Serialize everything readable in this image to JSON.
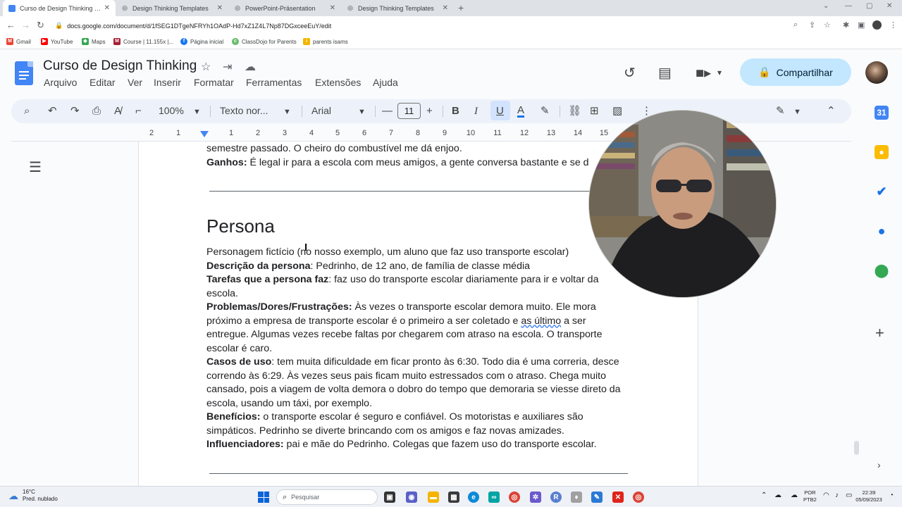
{
  "browser": {
    "tabs": [
      {
        "label": "Curso de Design Thinking - Docs",
        "favicon": "docs-icon",
        "active": true
      },
      {
        "label": "Design Thinking Templates",
        "favicon": "web-icon",
        "active": false
      },
      {
        "label": "PowerPoint-Präsentation",
        "favicon": "web-icon",
        "active": false
      },
      {
        "label": "Design Thinking Templates",
        "favicon": "web-icon",
        "active": false
      }
    ],
    "url": "docs.google.com/document/d/1fSEG1DTgeNFRYh1OAdP-Hd7xZ1Z4L7Np87DGxceeEuY/edit",
    "bookmarks": [
      {
        "label": "Gmail",
        "color": "#ea4335"
      },
      {
        "label": "YouTube",
        "color": "#ff0000"
      },
      {
        "label": "Maps",
        "color": "#34a853"
      },
      {
        "label": "Course | 11.155x |...",
        "color": "#a31f34"
      },
      {
        "label": "Página inicial",
        "color": "#1877f2"
      },
      {
        "label": "ClassDojo for Parents",
        "color": "#66bb6a"
      },
      {
        "label": "parents isams",
        "color": "#f4b400"
      }
    ]
  },
  "docs": {
    "title": "Curso de Design Thinking",
    "menu": [
      "Arquivo",
      "Editar",
      "Ver",
      "Inserir",
      "Formatar",
      "Ferramentas",
      "Extensões",
      "Ajuda"
    ],
    "share_label": "Compartilhar",
    "toolbar": {
      "zoom": "100%",
      "style": "Texto nor...",
      "font": "Arial",
      "font_size": "11"
    },
    "ruler_marks": [
      "2",
      "1",
      "1",
      "2",
      "3",
      "4",
      "5",
      "6",
      "7",
      "8",
      "9",
      "10",
      "11",
      "12",
      "13",
      "14",
      "15"
    ]
  },
  "document": {
    "top_line1": "semestre passado. O cheiro do combustível me dá enjoo.",
    "top_ganhos_label": "Ganhos:",
    "top_ganhos_text": " É legal ir para a escola com meus amigos, a gente conversa bastante e se d",
    "heading": "Persona",
    "intro": "Personagem fictício (no nosso exemplo, um aluno que faz uso transporte escolar)",
    "descricao_label": "Descrição da persona",
    "descricao_text": ": Pedrinho, de 12 ano, de família de classe média",
    "tarefas_label": "Tarefas que a persona faz",
    "tarefas_text": ": faz uso do transporte escolar diariamente para ir e voltar da escola.",
    "problemas_label": "Problemas/Dores/Frustrações:",
    "problemas_text_a": " Às vezes o transporte escolar demora muito. Ele mora próximo a empresa de transporte escolar é o primeiro a ser coletado e ",
    "problemas_misspelled": "as último",
    "problemas_text_b": " a ser entregue. Algumas vezes recebe faltas por chegarem com atraso na escola. O transporte escolar é caro.",
    "casos_label": "Casos de uso",
    "casos_text": ": tem muita dificuldade em ficar pronto às 6:30. Todo dia é uma correria, desce correndo às 6:29. Às vezes seus pais ficam muito estressados com o atraso. Chega muito cansado, pois a viagem de volta demora o dobro do tempo que demoraria se viesse direto da escola, usando um táxi, por exemplo.",
    "beneficios_label": "Benefícios:",
    "beneficios_text": " o transporte escolar é seguro e confiável. Os motoristas e auxiliares são simpáticos. Pedrinho se diverte brincando com os amigos e faz novas amizades.",
    "influenciadores_label": "Influenciadores:",
    "influenciadores_text": " pai e mãe do Pedrinho. Colegas que fazem uso do transporte escolar."
  },
  "taskbar": {
    "weather_temp": "16°C",
    "weather_desc": "Pred. nublado",
    "search_placeholder": "Pesquisar",
    "lang_top": "POR",
    "lang_bottom": "PTB2",
    "time": "22:39",
    "date": "05/09/2023"
  },
  "colors": {
    "accent": "#1a73e8",
    "share_bg": "#c2e7ff",
    "toolbar_bg": "#edf2fa"
  }
}
